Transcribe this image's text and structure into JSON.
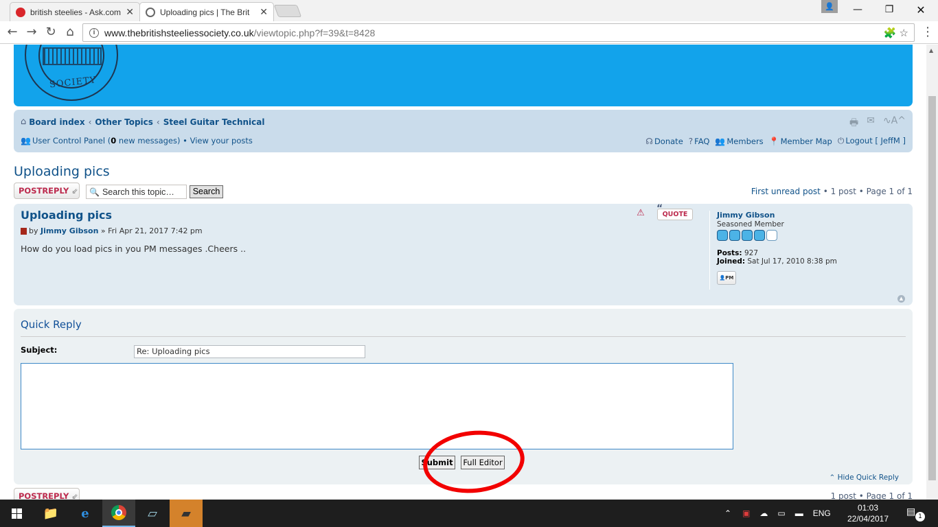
{
  "browser": {
    "tabs": [
      {
        "title": "british steelies - Ask.com",
        "favicon_color": "#d9262b"
      },
      {
        "title": "Uploading pics | The Brit",
        "favicon_color": "#888888"
      }
    ],
    "url_host": "www.thebritishsteeliessociety.co.uk",
    "url_path": "/viewtopic.php?f=39&t=8428"
  },
  "header": {
    "logo_text": "SOCIETY"
  },
  "navbar": {
    "breadcrumbs": [
      "Board index",
      "Other Topics",
      "Steel Guitar Technical"
    ],
    "ucp_label": "User Control Panel (",
    "new_messages_count": "0",
    "new_messages_suffix": " new messages)",
    "bullet": " • ",
    "view_posts": "View your posts",
    "right_links": [
      "Donate",
      "FAQ",
      "Members",
      "Member Map",
      "Logout [ JeffM ]"
    ]
  },
  "topic": {
    "title": "Uploading pics",
    "post_reply_label": "POSTREPLY",
    "search_placeholder": "Search this topic…",
    "search_button": "Search",
    "first_unread": "First unread post",
    "pagination_text": " • 1 post • Page 1 of 1",
    "pagination_bottom": "1 post • Page 1 of 1"
  },
  "post": {
    "title": "Uploading pics",
    "by": "by ",
    "author": "Jimmy Gibson",
    "date": " » Fri Apr 21, 2017 7:42 pm",
    "content": "How do you load pics in you PM messages .Cheers ..",
    "quote_label": "QUOTE",
    "profile": {
      "username": "Jimmy Gibson",
      "rank": "Seasoned Member",
      "posts_label": "Posts:",
      "posts_value": "927",
      "joined_label": "Joined:",
      "joined_value": "Sat Jul 17, 2010 8:38 pm",
      "pm_label": "PM"
    }
  },
  "quick_reply": {
    "title": "Quick Reply",
    "subject_label": "Subject:",
    "subject_value": "Re: Uploading pics",
    "submit_label": "Submit",
    "full_editor_label": "Full Editor",
    "hide_label": "Hide Quick Reply"
  },
  "taskbar": {
    "language": "ENG",
    "time": "01:03",
    "date": "22/04/2017",
    "notification_count": "1"
  },
  "colors": {
    "banner": "#12a3eb",
    "link": "#105289",
    "annotation": "#f20000"
  }
}
